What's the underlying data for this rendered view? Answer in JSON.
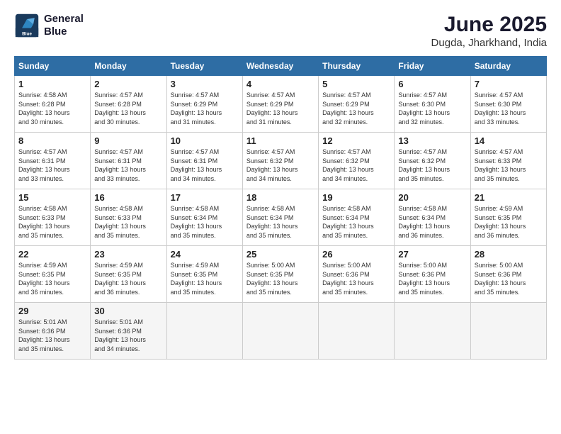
{
  "logo": {
    "line1": "General",
    "line2": "Blue"
  },
  "title": "June 2025",
  "subtitle": "Dugda, Jharkhand, India",
  "weekdays": [
    "Sunday",
    "Monday",
    "Tuesday",
    "Wednesday",
    "Thursday",
    "Friday",
    "Saturday"
  ],
  "rows": [
    [
      {
        "day": "1",
        "info": "Sunrise: 4:58 AM\nSunset: 6:28 PM\nDaylight: 13 hours\nand 30 minutes."
      },
      {
        "day": "2",
        "info": "Sunrise: 4:57 AM\nSunset: 6:28 PM\nDaylight: 13 hours\nand 30 minutes."
      },
      {
        "day": "3",
        "info": "Sunrise: 4:57 AM\nSunset: 6:29 PM\nDaylight: 13 hours\nand 31 minutes."
      },
      {
        "day": "4",
        "info": "Sunrise: 4:57 AM\nSunset: 6:29 PM\nDaylight: 13 hours\nand 31 minutes."
      },
      {
        "day": "5",
        "info": "Sunrise: 4:57 AM\nSunset: 6:29 PM\nDaylight: 13 hours\nand 32 minutes."
      },
      {
        "day": "6",
        "info": "Sunrise: 4:57 AM\nSunset: 6:30 PM\nDaylight: 13 hours\nand 32 minutes."
      },
      {
        "day": "7",
        "info": "Sunrise: 4:57 AM\nSunset: 6:30 PM\nDaylight: 13 hours\nand 33 minutes."
      }
    ],
    [
      {
        "day": "8",
        "info": "Sunrise: 4:57 AM\nSunset: 6:31 PM\nDaylight: 13 hours\nand 33 minutes."
      },
      {
        "day": "9",
        "info": "Sunrise: 4:57 AM\nSunset: 6:31 PM\nDaylight: 13 hours\nand 33 minutes."
      },
      {
        "day": "10",
        "info": "Sunrise: 4:57 AM\nSunset: 6:31 PM\nDaylight: 13 hours\nand 34 minutes."
      },
      {
        "day": "11",
        "info": "Sunrise: 4:57 AM\nSunset: 6:32 PM\nDaylight: 13 hours\nand 34 minutes."
      },
      {
        "day": "12",
        "info": "Sunrise: 4:57 AM\nSunset: 6:32 PM\nDaylight: 13 hours\nand 34 minutes."
      },
      {
        "day": "13",
        "info": "Sunrise: 4:57 AM\nSunset: 6:32 PM\nDaylight: 13 hours\nand 35 minutes."
      },
      {
        "day": "14",
        "info": "Sunrise: 4:57 AM\nSunset: 6:33 PM\nDaylight: 13 hours\nand 35 minutes."
      }
    ],
    [
      {
        "day": "15",
        "info": "Sunrise: 4:58 AM\nSunset: 6:33 PM\nDaylight: 13 hours\nand 35 minutes."
      },
      {
        "day": "16",
        "info": "Sunrise: 4:58 AM\nSunset: 6:33 PM\nDaylight: 13 hours\nand 35 minutes."
      },
      {
        "day": "17",
        "info": "Sunrise: 4:58 AM\nSunset: 6:34 PM\nDaylight: 13 hours\nand 35 minutes."
      },
      {
        "day": "18",
        "info": "Sunrise: 4:58 AM\nSunset: 6:34 PM\nDaylight: 13 hours\nand 35 minutes."
      },
      {
        "day": "19",
        "info": "Sunrise: 4:58 AM\nSunset: 6:34 PM\nDaylight: 13 hours\nand 35 minutes."
      },
      {
        "day": "20",
        "info": "Sunrise: 4:58 AM\nSunset: 6:34 PM\nDaylight: 13 hours\nand 36 minutes."
      },
      {
        "day": "21",
        "info": "Sunrise: 4:59 AM\nSunset: 6:35 PM\nDaylight: 13 hours\nand 36 minutes."
      }
    ],
    [
      {
        "day": "22",
        "info": "Sunrise: 4:59 AM\nSunset: 6:35 PM\nDaylight: 13 hours\nand 36 minutes."
      },
      {
        "day": "23",
        "info": "Sunrise: 4:59 AM\nSunset: 6:35 PM\nDaylight: 13 hours\nand 36 minutes."
      },
      {
        "day": "24",
        "info": "Sunrise: 4:59 AM\nSunset: 6:35 PM\nDaylight: 13 hours\nand 35 minutes."
      },
      {
        "day": "25",
        "info": "Sunrise: 5:00 AM\nSunset: 6:35 PM\nDaylight: 13 hours\nand 35 minutes."
      },
      {
        "day": "26",
        "info": "Sunrise: 5:00 AM\nSunset: 6:36 PM\nDaylight: 13 hours\nand 35 minutes."
      },
      {
        "day": "27",
        "info": "Sunrise: 5:00 AM\nSunset: 6:36 PM\nDaylight: 13 hours\nand 35 minutes."
      },
      {
        "day": "28",
        "info": "Sunrise: 5:00 AM\nSunset: 6:36 PM\nDaylight: 13 hours\nand 35 minutes."
      }
    ],
    [
      {
        "day": "29",
        "info": "Sunrise: 5:01 AM\nSunset: 6:36 PM\nDaylight: 13 hours\nand 35 minutes."
      },
      {
        "day": "30",
        "info": "Sunrise: 5:01 AM\nSunset: 6:36 PM\nDaylight: 13 hours\nand 34 minutes."
      },
      {
        "day": "",
        "info": ""
      },
      {
        "day": "",
        "info": ""
      },
      {
        "day": "",
        "info": ""
      },
      {
        "day": "",
        "info": ""
      },
      {
        "day": "",
        "info": ""
      }
    ]
  ]
}
